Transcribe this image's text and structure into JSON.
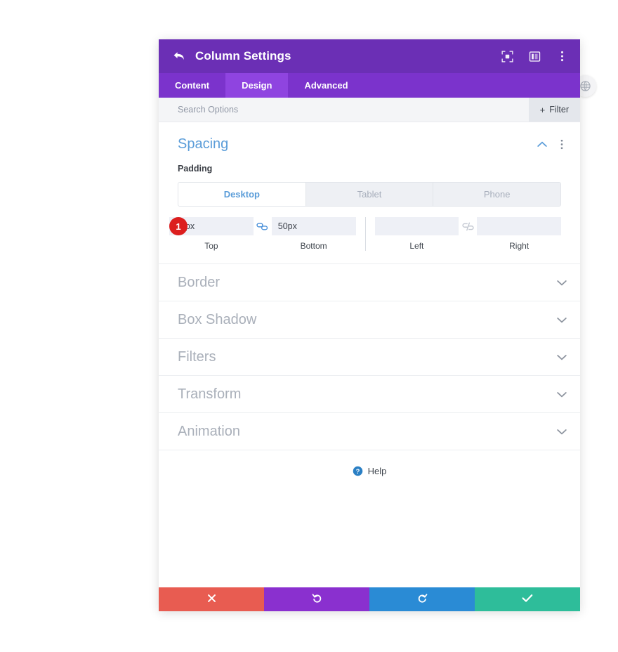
{
  "titlebar": {
    "back_icon": "back-arrow-icon",
    "title": "Column Settings",
    "actions": [
      {
        "icon": "focus-target-icon"
      },
      {
        "icon": "panel-layout-icon"
      },
      {
        "icon": "kebab-menu-icon"
      }
    ]
  },
  "edge_badge": {
    "icon": "close-circle-icon"
  },
  "tabs": [
    {
      "label": "Content",
      "active": false
    },
    {
      "label": "Design",
      "active": true
    },
    {
      "label": "Advanced",
      "active": false
    }
  ],
  "search": {
    "placeholder": "Search Options",
    "value": "",
    "filter_label": "Filter",
    "filter_plus": "+"
  },
  "spacing": {
    "title": "Spacing",
    "collapse_icon": "chevron-up-icon",
    "menu_icon": "kebab-menu-icon",
    "padding_label": "Padding",
    "device_tabs": [
      {
        "label": "Desktop",
        "active": true
      },
      {
        "label": "Tablet",
        "active": false
      },
      {
        "label": "Phone",
        "active": false
      }
    ],
    "badge": "1",
    "fields": [
      {
        "caption": "Top",
        "value": "50px",
        "placeholder": ""
      },
      {
        "caption": "Bottom",
        "value": "50px",
        "placeholder": ""
      },
      {
        "caption": "Left",
        "value": "",
        "placeholder": ""
      },
      {
        "caption": "Right",
        "value": "",
        "placeholder": ""
      }
    ],
    "link_left": {
      "icon": "link-chain-icon",
      "state": "linked",
      "color": "#4a90d9"
    },
    "link_right": {
      "icon": "broken-chain-icon",
      "state": "unlinked",
      "color": "#c3c8d1"
    }
  },
  "sections": [
    {
      "title": "Border",
      "chevron": "chevron-down-icon"
    },
    {
      "title": "Box Shadow",
      "chevron": "chevron-down-icon"
    },
    {
      "title": "Filters",
      "chevron": "chevron-down-icon"
    },
    {
      "title": "Transform",
      "chevron": "chevron-down-icon"
    },
    {
      "title": "Animation",
      "chevron": "chevron-down-icon"
    }
  ],
  "help": {
    "icon": "help-question-icon",
    "label": "Help"
  },
  "footer": [
    {
      "name": "cancel",
      "icon": "x-mark-icon",
      "color": "#e85c51"
    },
    {
      "name": "undo",
      "icon": "undo-arrow-icon",
      "color": "#8a30cf"
    },
    {
      "name": "redo",
      "icon": "redo-arrow-icon",
      "color": "#2a8bd5"
    },
    {
      "name": "save",
      "icon": "check-mark-icon",
      "color": "#2ebd9a"
    }
  ]
}
